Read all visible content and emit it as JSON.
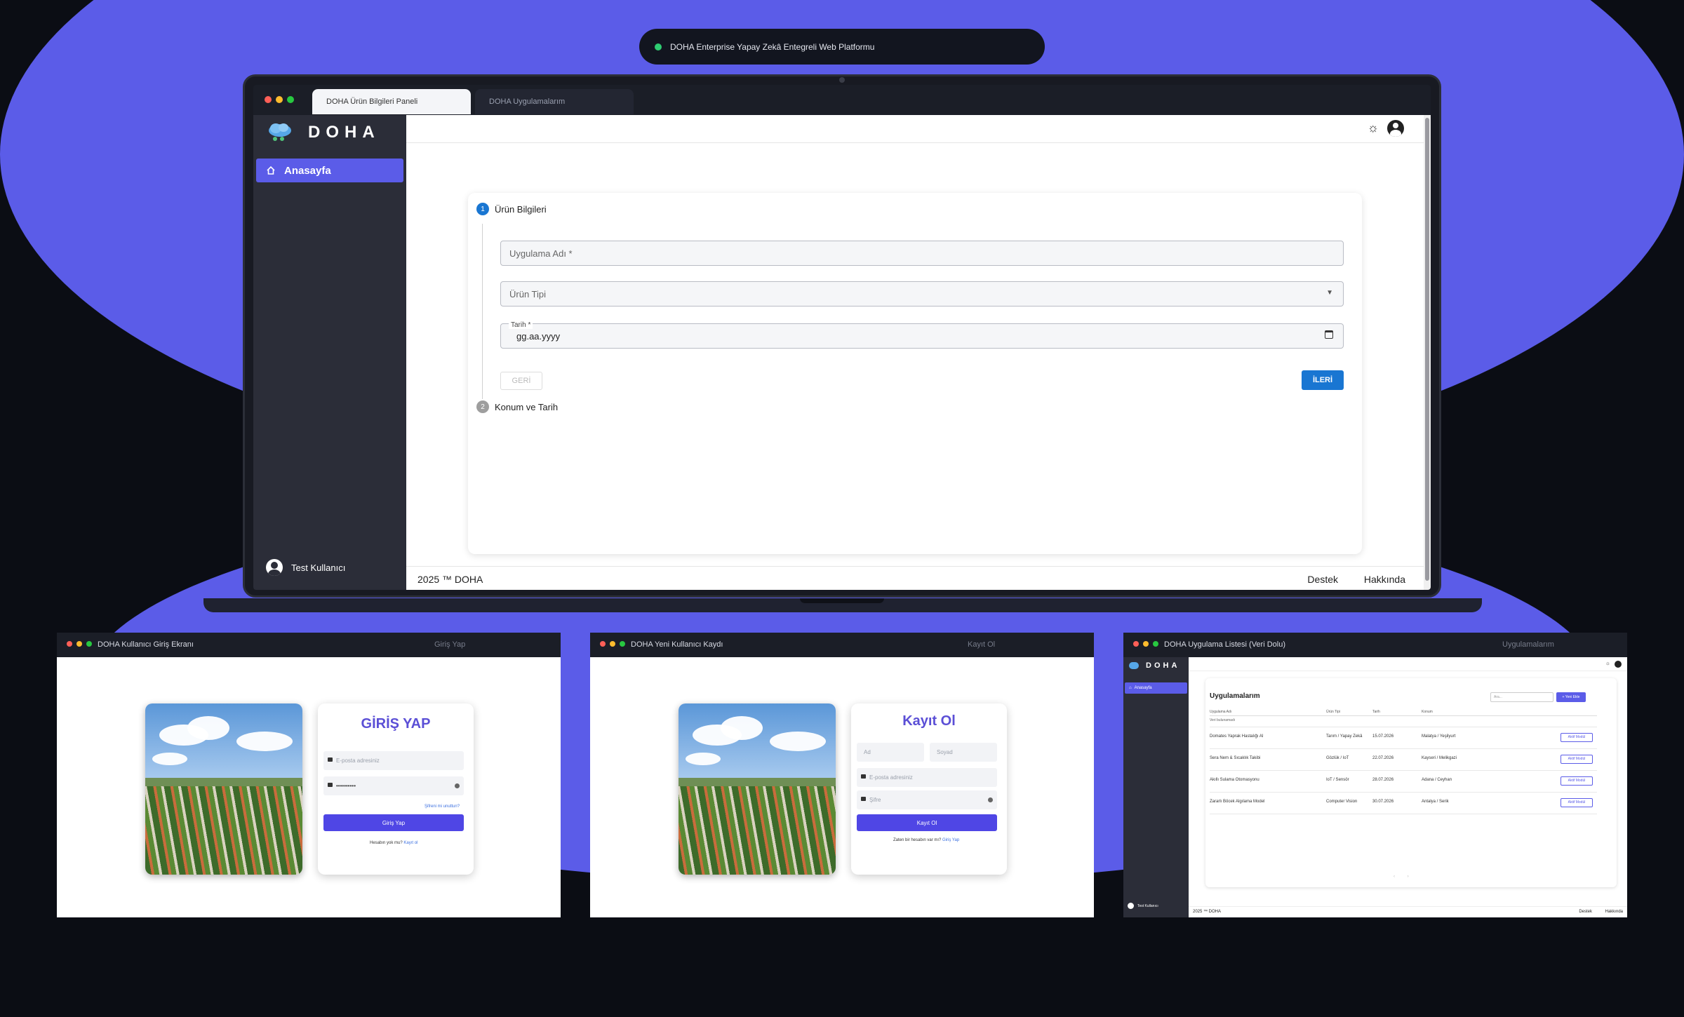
{
  "banner": {
    "text": "DOHA Enterprise Yapay Zekâ Entegreli Web Platformu",
    "status_color": "#2ecc71"
  },
  "colors": {
    "accent": "#5b5ce8",
    "primary_button": "#1976d2",
    "background": "#0b0d14"
  },
  "main_window": {
    "tabs": [
      {
        "label": "DOHA Ürün Bilgileri Paneli"
      },
      {
        "label": "DOHA Uygulamalarım"
      }
    ],
    "sidebar": {
      "logo_text": "DOHA",
      "nav_home": "Anasayfa",
      "user_name": "Test Kullanıcı"
    },
    "stepper": {
      "step1": {
        "number": "1",
        "title": "Ürün Bilgileri"
      },
      "step2": {
        "number": "2",
        "title": "Konum ve Tarih"
      },
      "app_name_placeholder": "Uygulama Adı *",
      "product_type_placeholder": "Ürün Tipi",
      "date_label": "Tarih *",
      "date_placeholder": "gg.aa.yyyy",
      "back_label": "GERİ",
      "next_label": "İLERİ"
    },
    "footer": {
      "copyright": "2025 ™ DOHA",
      "support": "Destek",
      "about": "Hakkında"
    }
  },
  "login_window": {
    "title": "DOHA Kullanıcı Giriş Ekranı",
    "center_title": "Giriş Yap",
    "heading": "GİRİŞ YAP",
    "email_placeholder": "E-posta adresiniz",
    "password_value": "••••••••••",
    "forgot": "Şifreni mi unuttun?",
    "submit": "Giriş Yap",
    "no_account": "Hesabın yok mu?",
    "register_link": "Kayıt ol"
  },
  "register_window": {
    "title": "DOHA Yeni Kullanıcı Kaydı",
    "center_title": "Kayıt Ol",
    "heading": "Kayıt Ol",
    "first_name": "Ad",
    "last_name": "Soyad",
    "email_placeholder": "E-posta adresiniz",
    "password_placeholder": "Şifre",
    "submit": "Kayıt Ol",
    "have_account": "Zaten bir hesabın var mı?",
    "login_link": "Giriş Yap"
  },
  "list_window": {
    "title": "DOHA Uygulama Listesi (Veri Dolu)",
    "center_title": "Uygulamalarım",
    "logo_text": "DOHA",
    "nav_home": "Anasayfa",
    "user_name": "Test Kullanıcı",
    "heading": "Uygulamalarım",
    "search_placeholder": "Ara...",
    "new_button": "+ Yeni Ekle",
    "columns": [
      "Uygulama Adı",
      "Ürün Tipi",
      "Tarih",
      "Konum"
    ],
    "empty_text": "Veri bulunamadı",
    "rows": [
      {
        "name": "Domates Yaprak Hastalığı AI",
        "type": "Tarım / Yapay Zekâ",
        "date": "15.07.2026",
        "location": "Malatya / Yeşilyurt",
        "action": "Aktif Modül"
      },
      {
        "name": "Sera Nem & Sıcaklık Takibi",
        "type": "Gözlük / IoT",
        "date": "22.07.2026",
        "location": "Kayseri / Melikgazi",
        "action": "Aktif Modül"
      },
      {
        "name": "Akıllı Sulama Otomasyonu",
        "type": "IoT / Sensör",
        "date": "28.07.2026",
        "location": "Adana / Ceyhan",
        "action": "Aktif Modül"
      },
      {
        "name": "Zararlı Böcek Algılama Model",
        "type": "Computer Vision",
        "date": "30.07.2026",
        "location": "Antalya / Serik",
        "action": "Aktif Modül"
      }
    ],
    "footer": {
      "copyright": "2025 ™ DOHA",
      "support": "Destek",
      "about": "Hakkında"
    }
  }
}
